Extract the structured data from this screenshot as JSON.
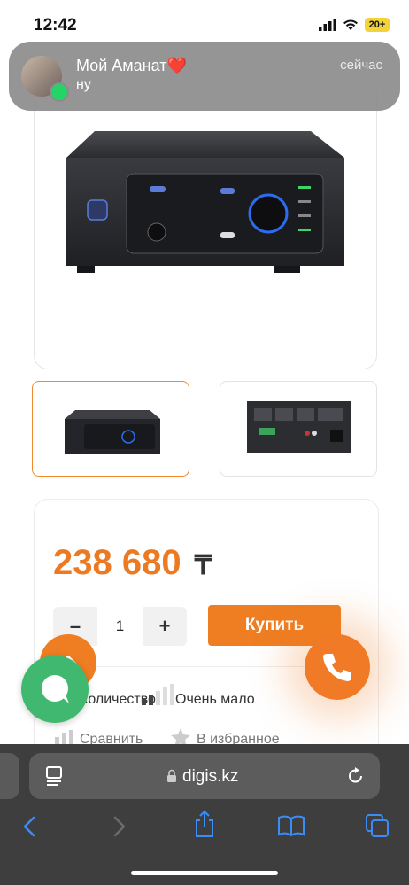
{
  "status_bar": {
    "time": "12:42",
    "battery": "20+"
  },
  "notification": {
    "sender": "Мой Аманат❤️",
    "message": "ну",
    "time": "сейчас"
  },
  "product": {
    "price": "238 680",
    "currency": "₸",
    "quantity": "1",
    "minus_label": "–",
    "plus_label": "+",
    "buy_label": "Купить",
    "stock_label": "Количество:",
    "stock_value": "Очень мало",
    "compare_label": "Сравнить",
    "favorite_label": "В избранное"
  },
  "browser": {
    "url": "digis.kz"
  },
  "colors": {
    "accent": "#ef7d22",
    "chat": "#40b86f",
    "chrome": "#3e3e3e"
  }
}
